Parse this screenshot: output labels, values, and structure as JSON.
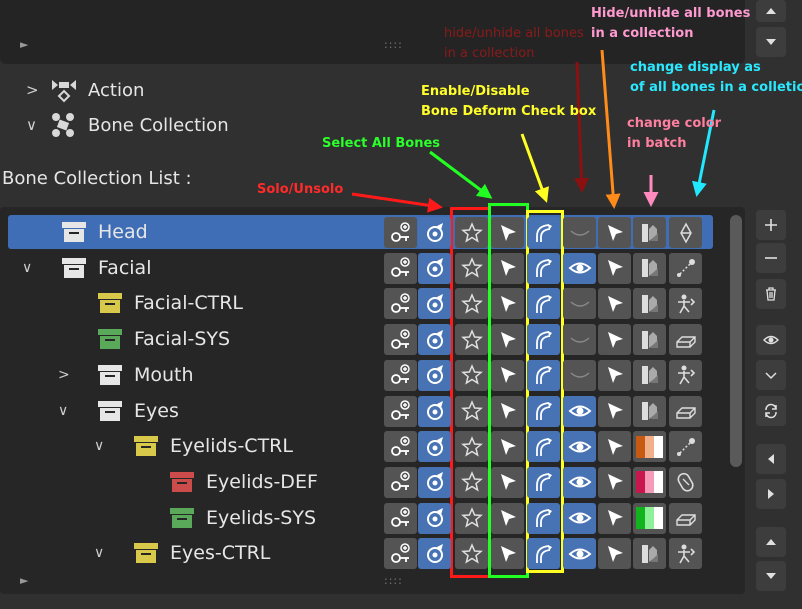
{
  "top_panel": {
    "play": "►",
    "grip": "::::"
  },
  "sections": [
    {
      "label": "Action",
      "chevron": ">",
      "icon": "action-icon"
    },
    {
      "label": "Bone Collection",
      "chevron": "∨",
      "icon": "bone-collection-icon"
    }
  ],
  "list": {
    "title": "Bone Collection List :",
    "rows": [
      {
        "name": "Head",
        "indent": 0,
        "chevron": "",
        "color": "#e6e6e6",
        "visible": false,
        "selected": true,
        "display": "octahedral-icon",
        "swatch": null
      },
      {
        "name": "Facial",
        "indent": 0,
        "chevron": "∨",
        "color": "#e6e6e6",
        "visible": true,
        "selected": false,
        "display": "stick-icon",
        "swatch": null
      },
      {
        "name": "Facial-CTRL",
        "indent": 1,
        "chevron": "",
        "color": "#d9c94a",
        "visible": false,
        "selected": false,
        "display": "armature-pose-icon",
        "swatch": null
      },
      {
        "name": "Facial-SYS",
        "indent": 1,
        "chevron": "",
        "color": "#5aa85a",
        "visible": false,
        "selected": false,
        "display": "bbone-icon",
        "swatch": null
      },
      {
        "name": "Mouth",
        "indent": 1,
        "chevron": ">",
        "color": "#e6e6e6",
        "visible": false,
        "selected": false,
        "display": "armature-pose-icon",
        "swatch": null
      },
      {
        "name": "Eyes",
        "indent": 1,
        "chevron": "∨",
        "color": "#e6e6e6",
        "visible": true,
        "selected": false,
        "display": "bbone-icon",
        "swatch": null
      },
      {
        "name": "Eyelids-CTRL",
        "indent": 2,
        "chevron": "∨",
        "color": "#d9c94a",
        "visible": true,
        "selected": false,
        "display": "stick-icon",
        "swatch": [
          "#c65a12",
          "#f2b08a",
          "#ffffff"
        ]
      },
      {
        "name": "Eyelids-DEF",
        "indent": 3,
        "chevron": "",
        "color": "#cc4b4b",
        "visible": true,
        "selected": false,
        "display": "envelope-icon",
        "swatch": [
          "#c8174e",
          "#f59ab8",
          "#ffffff"
        ]
      },
      {
        "name": "Eyelids-SYS",
        "indent": 3,
        "chevron": "",
        "color": "#5aa85a",
        "visible": true,
        "selected": false,
        "display": "bbone-icon",
        "swatch": [
          "#13b31f",
          "#8ff09a",
          "#ffffff"
        ]
      },
      {
        "name": "Eyes-CTRL",
        "indent": 2,
        "chevron": "∨",
        "color": "#d9c94a",
        "visible": true,
        "selected": false,
        "display": "armature-pose-icon",
        "swatch": null
      }
    ],
    "bottom_play": "►",
    "bottom_grip": "::::"
  },
  "annotations": [
    {
      "text": "Solo/Unsolo",
      "color": "#ff2a2a"
    },
    {
      "text": "Select All Bones",
      "color": "#2aff2a"
    },
    {
      "text": "Enable/Disable\nBone Deform Check box",
      "color": "#ffff2a"
    },
    {
      "text": "hide/unhide all bones\nin a collection",
      "color": "#8b1a1a"
    },
    {
      "text": "Hide/unhide all bones\nin a collection",
      "color": "#ff9ad0"
    },
    {
      "text": "change display as\nof all bones in a colletion",
      "color": "#2ae8ff"
    },
    {
      "text": "change color\nin batch",
      "color": "#ff7fa0"
    }
  ],
  "colors": {
    "accent": "#4772b3",
    "selected_row": "#3f6db6"
  }
}
